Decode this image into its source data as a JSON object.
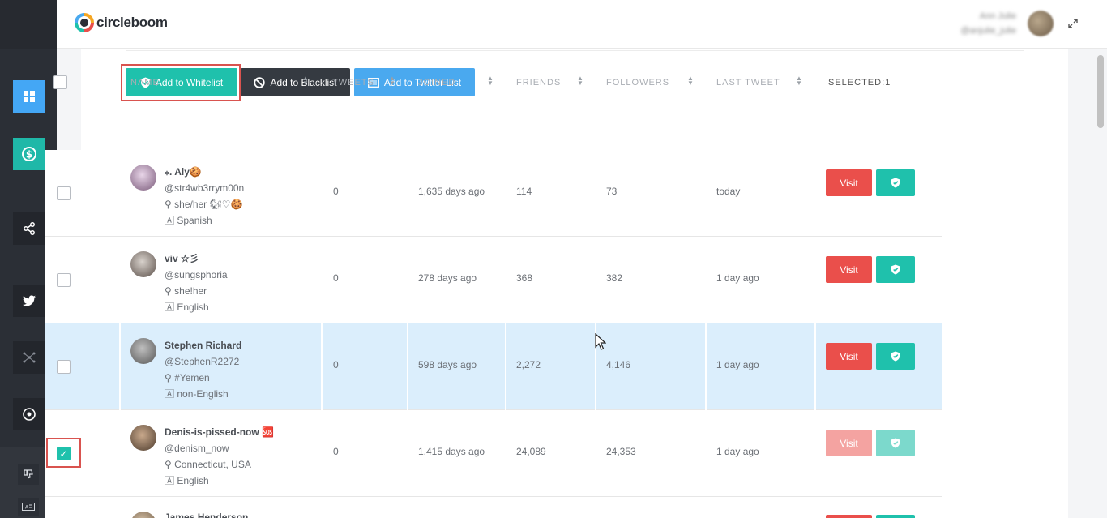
{
  "brand": {
    "name": "circleboom"
  },
  "header": {
    "user_name": "Ann Julie",
    "user_handle": "@anjulie_julie"
  },
  "toolbar": {
    "whitelist_label": "Add to Whitelist",
    "blacklist_label": "Add to Blacklist",
    "twitter_list_label": "Add to Twitter List"
  },
  "table": {
    "columns": [
      "NAME",
      "TWEETS",
      "JOINED",
      "FRIENDS",
      "FOLLOWERS",
      "LAST TWEET"
    ],
    "selected_label": "SELECTED:1",
    "visit_label": "Visit",
    "rows": [
      {
        "name": "⁎. Aly🍪",
        "handle": "@str4wb3rrym00n",
        "location": "she/her 🐿♡🍪",
        "language": "Spanish",
        "tweets": "0",
        "joined": "1,635 days ago",
        "friends": "114",
        "followers": "73",
        "last_tweet": "today"
      },
      {
        "name": "viv ☆彡",
        "handle": "@sungsphoria",
        "location": "she!her",
        "language": "English",
        "tweets": "0",
        "joined": "278 days ago",
        "friends": "368",
        "followers": "382",
        "last_tweet": "1 day ago"
      },
      {
        "name": "Stephen Richard",
        "handle": "@StephenR2272",
        "location": "#Yemen",
        "language": "non-English",
        "tweets": "0",
        "joined": "598 days ago",
        "friends": "2,272",
        "followers": "4,146",
        "last_tweet": "1 day ago"
      },
      {
        "name": "Denis-is-pissed-now 🆘",
        "handle": "@denism_now",
        "location": "Connecticut, USA",
        "language": "English",
        "tweets": "0",
        "joined": "1,415 days ago",
        "friends": "24,089",
        "followers": "24,353",
        "last_tweet": "1 day ago"
      },
      {
        "name": "James Henderson"
      }
    ]
  },
  "colors": {
    "teal": "#1fc1ac",
    "red": "#ea4f4b",
    "blue": "#4aa9ef",
    "dark": "#353a41",
    "highlight": "#d9534f"
  }
}
